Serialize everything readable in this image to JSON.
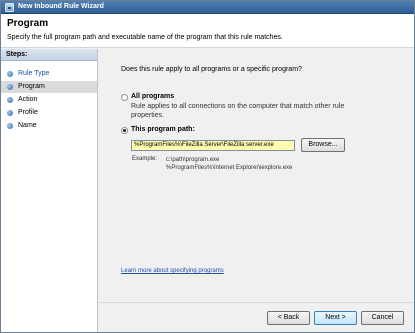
{
  "window": {
    "title": "New Inbound Rule Wizard"
  },
  "header": {
    "title": "Program",
    "description": "Specify the full program path and executable name of the program that this rule matches."
  },
  "steps": {
    "heading": "Steps:",
    "items": [
      {
        "label": "Rule Type",
        "state": "link"
      },
      {
        "label": "Program",
        "state": "current"
      },
      {
        "label": "Action",
        "state": "pending"
      },
      {
        "label": "Profile",
        "state": "pending"
      },
      {
        "label": "Name",
        "state": "pending"
      }
    ]
  },
  "content": {
    "question": "Does this rule apply to all programs or a specific program?",
    "all_programs": {
      "label": "All programs",
      "desc_line1": "Rule applies to all connections on the computer that match other rule",
      "desc_line2": "properties.",
      "checked": false
    },
    "this_program": {
      "label": "This program path:",
      "checked": true,
      "path_value": "%ProgramFiles%\\FileZilla Server\\FileZilla server.exe",
      "browse_label": "Browse...",
      "example_label": "Example:",
      "example_line1": "c:\\path\\program.exe",
      "example_line2": "%ProgramFiles%\\Internet Explorer\\iexplore.exe"
    },
    "learn_more": "Learn more about specifying programs"
  },
  "footer": {
    "back_label": "< Back",
    "next_label": "Next >",
    "cancel_label": "Cancel"
  },
  "colors": {
    "titlebar": "#2f5e94",
    "link": "#1f4fa8",
    "input_highlight": "#fffbb0",
    "current_step_bg": "#dadada"
  }
}
